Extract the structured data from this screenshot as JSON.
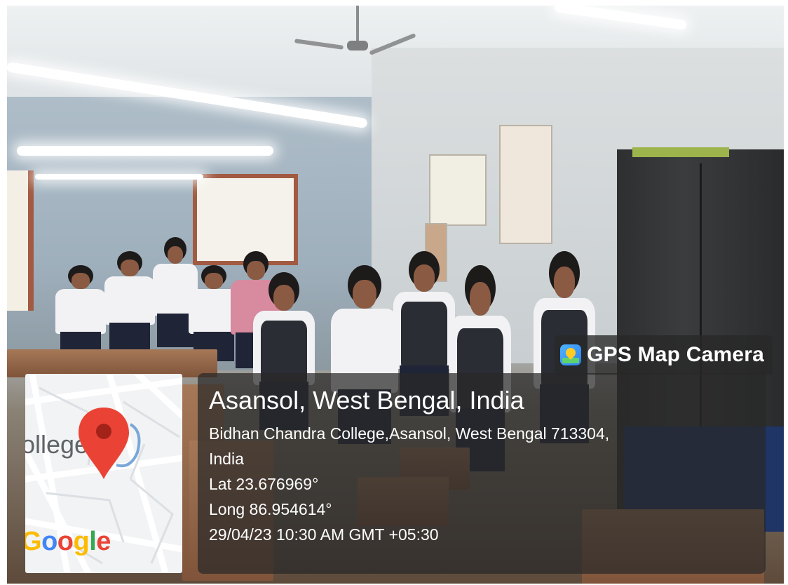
{
  "overlay": {
    "app_name": "GPS Map Camera",
    "place_title": "Asansol, West Bengal, India",
    "address_line1": "Bidhan Chandra College,Asansol, West Bengal 713304,",
    "address_line2": "India",
    "latitude": "Lat 23.676969°",
    "longitude": "Long 86.954614°",
    "timestamp": "29/04/23 10:30 AM GMT +05:30"
  },
  "map": {
    "place_label": "ollege",
    "provider_logo": "Google",
    "pin_color": "#ea4335",
    "logo_colors": [
      "#fbbc05",
      "#4285f4",
      "#ea4335",
      "#fbbc05",
      "#34a853",
      "#ea4335"
    ]
  },
  "icons": {
    "app_icon": "gps-map-camera-icon",
    "map_pin": "map-pin-icon"
  }
}
